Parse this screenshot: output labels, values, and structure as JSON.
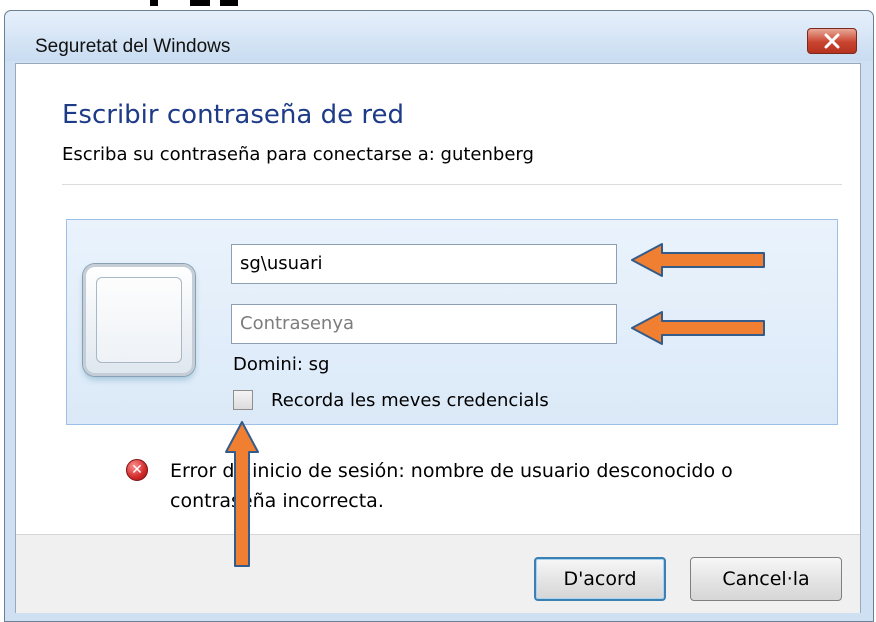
{
  "window": {
    "title": "Seguretat del Windows",
    "close_label": "×"
  },
  "dialog": {
    "heading": "Escribir contraseña de red",
    "subheading": "Escriba su contraseña para conectarse a: gutenberg"
  },
  "credentials": {
    "username_value": "sg\\usuari",
    "password_placeholder": "Contrasenya",
    "domain_text": "Domini: sg",
    "remember_label": "Recorda les meves credencials",
    "remember_checked": false
  },
  "error": {
    "icon": "error-x-icon",
    "message": "Error de inicio de sesión: nombre de usuario desconocido o contraseña incorrecta."
  },
  "buttons": {
    "ok_label": "D'acord",
    "cancel_label": "Cancel·la"
  },
  "annotations": {
    "arrow_color": "#f07f32"
  }
}
